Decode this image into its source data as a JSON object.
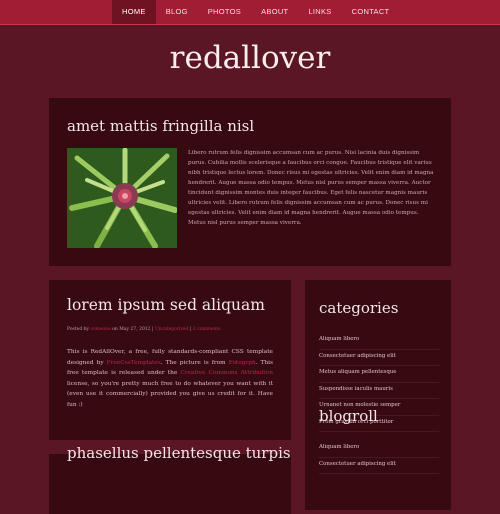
{
  "nav": {
    "items": [
      {
        "label": "HOME",
        "active": true
      },
      {
        "label": "BLOG",
        "active": false
      },
      {
        "label": "PHOTOS",
        "active": false
      },
      {
        "label": "ABOUT",
        "active": false
      },
      {
        "label": "LINKS",
        "active": false
      },
      {
        "label": "CONTACT",
        "active": false
      }
    ]
  },
  "site": {
    "title": "redallover"
  },
  "featured": {
    "title": "amet mattis fringilla nisl",
    "image_icon": "flower-photo",
    "text": "Libero rutrum felis dignissim accumsan cum ac purus. Nisi lacinia duis dignissim purus. Cubilia mollis scelerisque a faucibus orci congue. Faucibus tristique elit varius nibh tristique lectus lorem. Donec risus mi egestas ultricies. Velit enim diam id magna hendrerit. Augue massa odio tempus. Metus nisl purus semper massa viverra. Auctor tincidunt dignissim montes duis integer faucibus. Eget felis nascetur magnis mauris ultricies velit. Libero rutrum felis dignissim accumsan cum ac purus. Donec risus mi egestas ultricies. Velit enim diam id magna hendrerit. Augue massa odio tempus. Metus nisl purus semper massa viverra."
  },
  "post1": {
    "title": "lorem ipsum sed aliquam",
    "meta": {
      "posted_by": "Posted by",
      "author": "someone",
      "on_date": "on May 27, 2012",
      "sep1": "|",
      "category": "Uncategorized",
      "sep2": "|",
      "comments": "2 comments"
    },
    "body": {
      "part1": "This is RedAllOver, a free, fully standards-compliant CSS template designed by",
      "designer": "FreeCssTemplates",
      "part2": ". The picture is from",
      "picture_source": "Fotogrph",
      "part3": ". This free template is released under the",
      "license": "Creative Commons Attribution",
      "part4": "license, so you're pretty much free to do whatever you want with it (even use it commercially) provided you give us credit for it. Have fun :)"
    }
  },
  "post2": {
    "title": "phasellus pellentesque turpis"
  },
  "sidebar": {
    "categories_heading": "categories",
    "categories": [
      "Aliquam libero",
      "Consectetuer adipiscing elit",
      "Metus aliquam pellentesque",
      "Suspendisse iaculis mauris",
      "Urnanet non molestie semper",
      "Proin gravida orci porttitor"
    ],
    "blogroll_heading": "blogroll",
    "blogroll": [
      "Aliquam libero",
      "Consectetuer adipiscing elit"
    ]
  },
  "colors": {
    "background": "#5a1622",
    "topbar": "#a01d33",
    "panel": "#370a12",
    "link": "#b82a45"
  }
}
